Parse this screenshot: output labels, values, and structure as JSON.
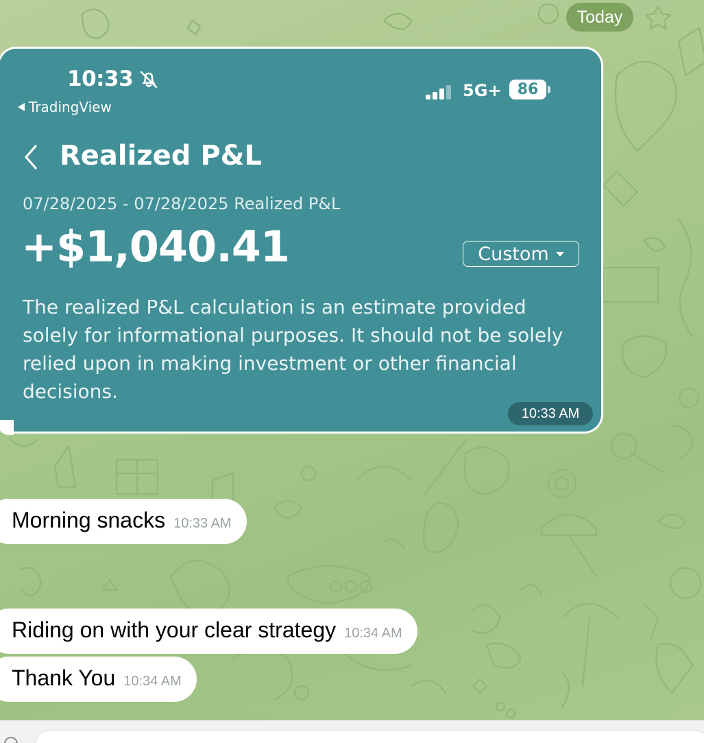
{
  "chat": {
    "date_label": "Today",
    "image_message": {
      "sent_time": "10:33 AM",
      "screenshot": {
        "status_bar": {
          "time": "10:33",
          "back_app": "TradingView",
          "network": "5G+",
          "battery": "86"
        },
        "title": "Realized P&L",
        "date_range": "07/28/2025 - 07/28/2025 Realized P&L",
        "amount": "+$1,040.41",
        "period_selector": "Custom",
        "disclaimer": "The realized P&L calculation is an estimate provided solely for informational purposes. It should not be solely relied upon in making investment or other financial decisions.",
        "colors": {
          "background": "#418f97",
          "text": "#ffffff"
        }
      }
    },
    "messages": [
      {
        "text": "Morning snacks",
        "time": "10:33 AM"
      },
      {
        "text": "Riding on with your clear strategy",
        "time": "10:34 AM"
      },
      {
        "text": "Thank You",
        "time": "10:34 AM"
      }
    ],
    "colors": {
      "wallpaper": "#a8c78c",
      "date_pill": "#7ea35f",
      "bubble": "#ffffff"
    }
  }
}
